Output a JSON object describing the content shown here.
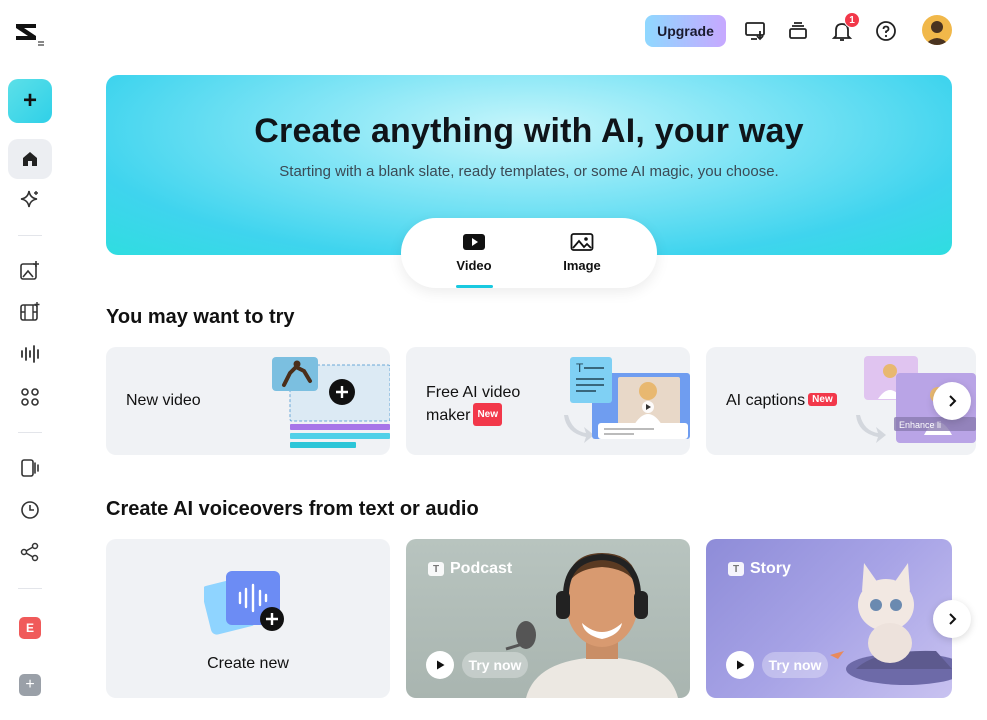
{
  "sidebar": {
    "create_symbol": "+",
    "items": [
      {
        "icon": "home-icon"
      },
      {
        "icon": "sparkle-icon"
      },
      {
        "icon": "image-plus-icon"
      },
      {
        "icon": "film-plus-icon"
      },
      {
        "icon": "audio-wave-icon"
      },
      {
        "icon": "apps-grid-icon"
      },
      {
        "icon": "slides-icon"
      },
      {
        "icon": "clock-icon"
      },
      {
        "icon": "share-icon"
      }
    ],
    "team_letter": "E",
    "add_symbol": "+"
  },
  "topbar": {
    "upgrade_label": "Upgrade",
    "notification_count": "1"
  },
  "hero": {
    "title": "Create anything with AI, your way",
    "subtitle": "Starting with a blank slate, ready templates, or some AI magic, you choose.",
    "tabs": [
      {
        "label": "Video",
        "active": true
      },
      {
        "label": "Image",
        "active": false
      }
    ]
  },
  "try_section": {
    "title": "You may want to try",
    "cards": [
      {
        "label": "New video",
        "badge": ""
      },
      {
        "label_line1": "Free AI video",
        "label_line2": "maker",
        "badge": "New"
      },
      {
        "label": "AI captions",
        "badge": "New",
        "overlay_text": "Enhance li"
      }
    ]
  },
  "voice_section": {
    "title": "Create AI voiceovers from text or audio",
    "cards": [
      {
        "label": "Create new"
      },
      {
        "tag": "Podcast",
        "tag_icon": "T",
        "cta": "Try now"
      },
      {
        "tag": "Story",
        "tag_icon": "T",
        "cta": "Try now"
      }
    ]
  },
  "colors": {
    "accent": "#19c9e0",
    "badge_red": "#f2384a",
    "card_bg": "#f0f2f5"
  }
}
